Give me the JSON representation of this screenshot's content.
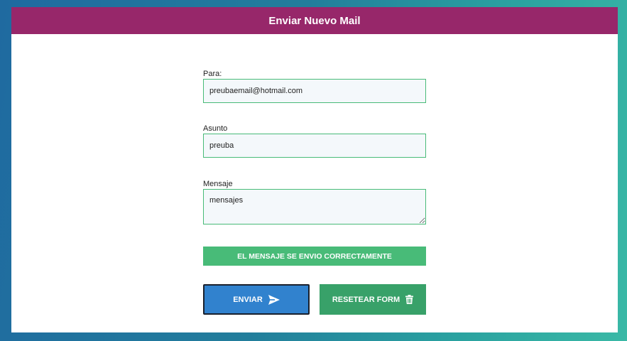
{
  "header": {
    "title": "Enviar Nuevo Mail"
  },
  "form": {
    "para": {
      "label": "Para:",
      "value": "preubaemail@hotmail.com"
    },
    "asunto": {
      "label": "Asunto",
      "value": "preuba"
    },
    "mensaje": {
      "label": "Mensaje",
      "value": "mensajes"
    },
    "success_message": "EL MENSAJE SE ENVIO CORRECTAMENTE",
    "send_label": "ENVIAR",
    "reset_label": "RESETEAR FORM"
  },
  "icons": {
    "send": "paper-plane-icon",
    "reset": "trash-icon"
  },
  "colors": {
    "header": "#97276a",
    "success": "#48bb78",
    "send_button": "#3182ce",
    "reset_button": "#38a169"
  }
}
